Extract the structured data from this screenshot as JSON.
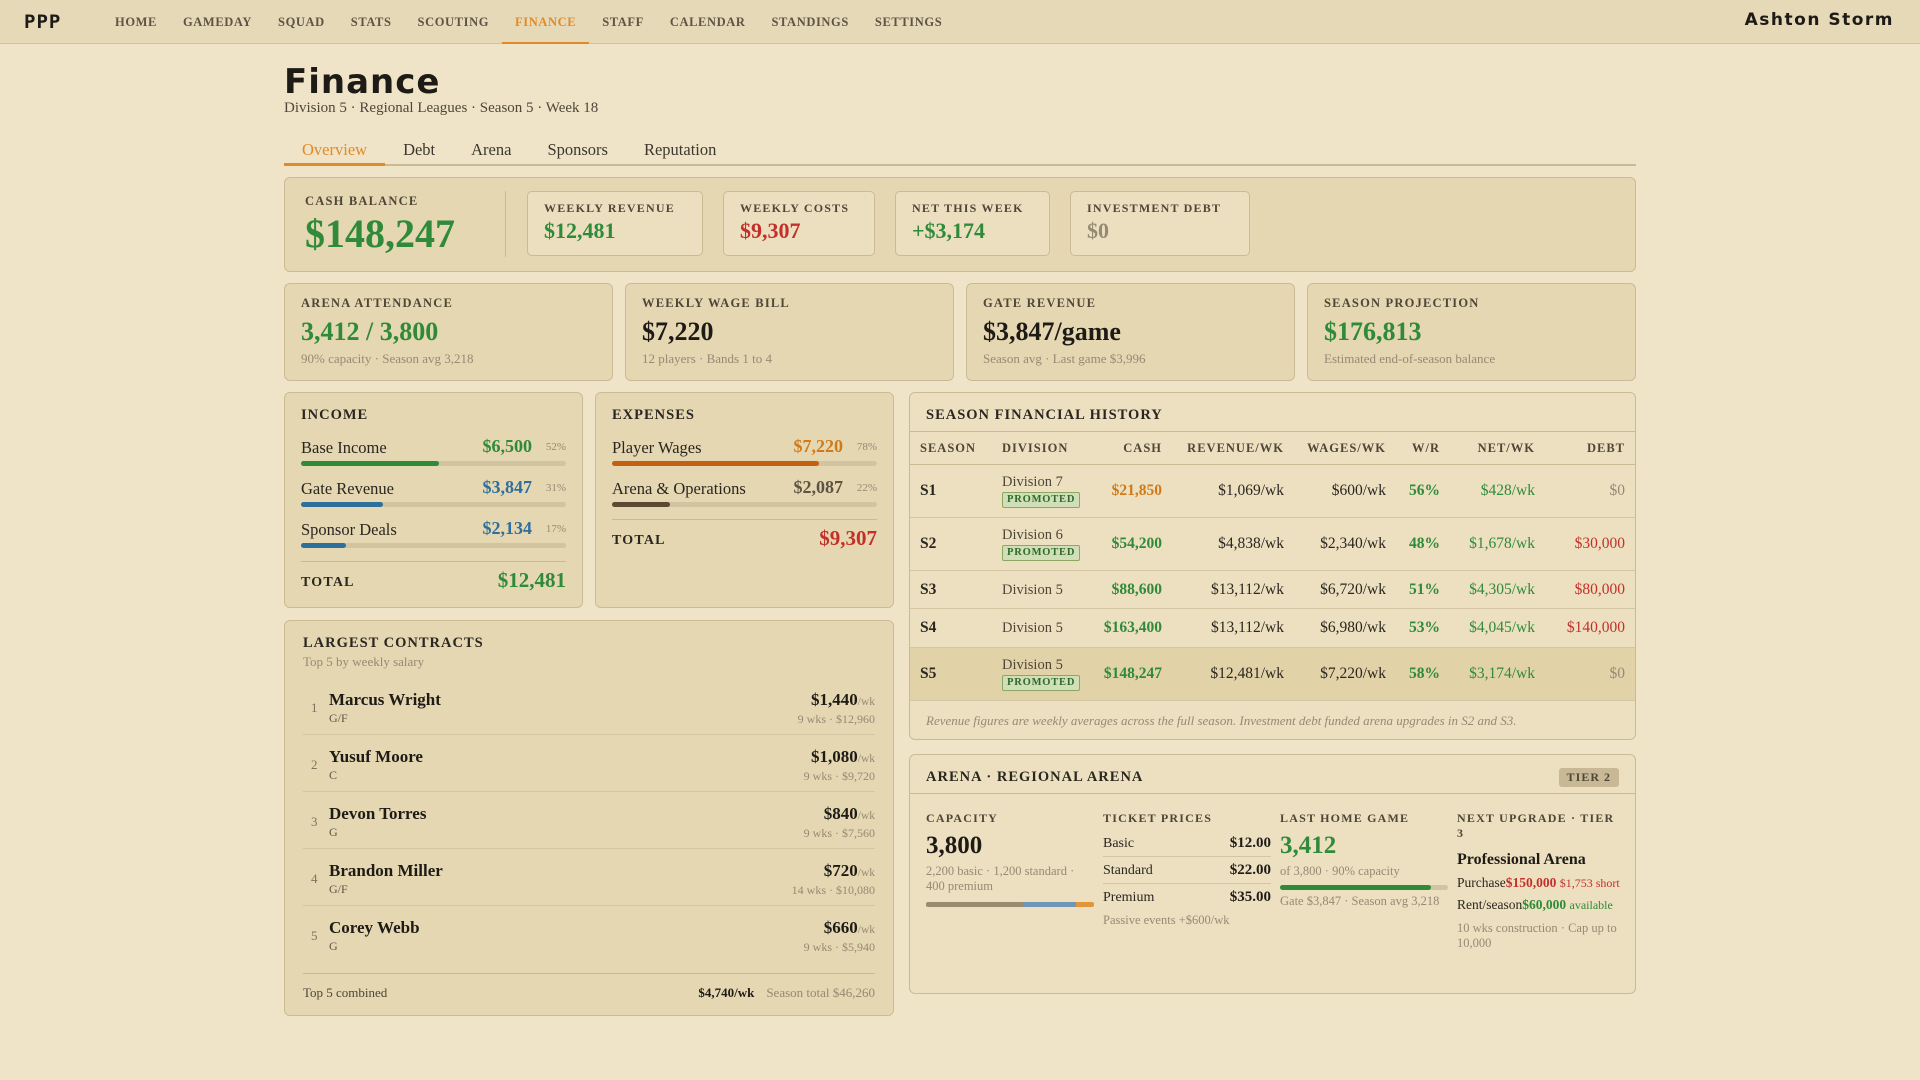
{
  "app": {
    "logo": "PPP",
    "user": "Ashton Storm"
  },
  "nav": [
    "HOME",
    "GAMEDAY",
    "SQUAD",
    "STATS",
    "SCOUTING",
    "FINANCE",
    "STAFF",
    "CALENDAR",
    "STANDINGS",
    "SETTINGS"
  ],
  "page": {
    "title": "Finance",
    "subtitle": "Division 5 · Regional Leagues · Season 5 · Week 18"
  },
  "tabs": [
    "Overview",
    "Debt",
    "Arena",
    "Sponsors",
    "Reputation"
  ],
  "hero": {
    "cash_label": "Cash Balance",
    "cash_value": "$148,247",
    "weekly_revenue_label": "Weekly Revenue",
    "weekly_revenue": "$12,481",
    "weekly_costs_label": "Weekly Costs",
    "weekly_costs": "$9,307",
    "net_label": "Net This Week",
    "net": "+$3,174",
    "debt_label": "Investment Debt",
    "debt": "$0"
  },
  "stats": [
    {
      "label": "Arena Attendance",
      "value": "3,412 / 3,800",
      "sub": "90% capacity · Season avg 3,218"
    },
    {
      "label": "Weekly Wage Bill",
      "value": "$7,220",
      "sub": "12 players · Bands 1 to 4"
    },
    {
      "label": "Gate Revenue",
      "value": "$3,847/game",
      "sub": "Season avg · Last game $3,996"
    },
    {
      "label": "Season Projection",
      "value": "$176,813",
      "sub": "Estimated end-of-season balance"
    }
  ],
  "income": {
    "title": "Income",
    "items": [
      {
        "name": "Base Income",
        "amount": "$6,500",
        "pct": "52%",
        "share": 0.52,
        "color": "#2f8a3a"
      },
      {
        "name": "Gate Revenue",
        "amount": "$3,847",
        "pct": "31%",
        "share": 0.31,
        "color": "#2e6f9c"
      },
      {
        "name": "Sponsor Deals",
        "amount": "$2,134",
        "pct": "17%",
        "share": 0.17,
        "color": "#2e6f9c"
      }
    ],
    "total_label": "Total",
    "total": "$12,481"
  },
  "expenses": {
    "title": "Expenses",
    "items": [
      {
        "name": "Player Wages",
        "amount": "$7,220",
        "pct": "78%",
        "share": 0.78,
        "color": "#c2610f"
      },
      {
        "name": "Arena & Operations",
        "amount": "$2,087",
        "pct": "22%",
        "share": 0.22,
        "color": "#5e4a32"
      }
    ],
    "total_label": "Total",
    "total": "$9,307"
  },
  "contracts": {
    "title": "Largest Contracts",
    "subtitle": "Top 5 by weekly salary",
    "rows": [
      {
        "rank": "1",
        "name": "Marcus Wright",
        "pos": "G/F",
        "salary": "$1,440",
        "unit": "/wk",
        "detail": "9 wks · $12,960"
      },
      {
        "rank": "2",
        "name": "Yusuf Moore",
        "pos": "C",
        "salary": "$1,080",
        "unit": "/wk",
        "detail": "9 wks · $9,720"
      },
      {
        "rank": "3",
        "name": "Devon Torres",
        "pos": "G",
        "salary": "$840",
        "unit": "/wk",
        "detail": "9 wks · $7,560"
      },
      {
        "rank": "4",
        "name": "Brandon Miller",
        "pos": "G/F",
        "salary": "$720",
        "unit": "/wk",
        "detail": "14 wks · $10,080"
      },
      {
        "rank": "5",
        "name": "Corey Webb",
        "pos": "G",
        "salary": "$660",
        "unit": "/wk",
        "detail": "9 wks · $5,940"
      }
    ],
    "footer_label": "Top 5 combined",
    "footer_weekly": "$4,740/wk",
    "footer_total": "Season total $46,260"
  },
  "history": {
    "title": "Season Financial History",
    "headers": [
      "Season",
      "Division",
      "Cash",
      "Revenue/wk",
      "Wages/wk",
      "W/R",
      "Net/wk",
      "Debt"
    ],
    "rows": [
      {
        "season": "S1",
        "division": "Division 7",
        "badge": "PROMOTED",
        "cash": "$21,850",
        "cash_color": "orange",
        "revenue": "$1,069/wk",
        "wages": "$600/wk",
        "wr": "56%",
        "net": "$428/wk",
        "debt": "$0",
        "debt_color": "gray"
      },
      {
        "season": "S2",
        "division": "Division 6",
        "badge": "PROMOTED",
        "cash": "$54,200",
        "cash_color": "green",
        "revenue": "$4,838/wk",
        "wages": "$2,340/wk",
        "wr": "48%",
        "net": "$1,678/wk",
        "debt": "$30,000",
        "debt_color": "red"
      },
      {
        "season": "S3",
        "division": "Division 5",
        "badge": "",
        "cash": "$88,600",
        "cash_color": "green",
        "revenue": "$13,112/wk",
        "wages": "$6,720/wk",
        "wr": "51%",
        "net": "$4,305/wk",
        "debt": "$80,000",
        "debt_color": "red"
      },
      {
        "season": "S4",
        "division": "Division 5",
        "badge": "",
        "cash": "$163,400",
        "cash_color": "green",
        "revenue": "$13,112/wk",
        "wages": "$6,980/wk",
        "wr": "53%",
        "net": "$4,045/wk",
        "debt": "$140,000",
        "debt_color": "red"
      },
      {
        "season": "S5",
        "division": "Division 5",
        "badge": "PROMOTED",
        "cash": "$148,247",
        "cash_color": "green",
        "revenue": "$12,481/wk",
        "wages": "$7,220/wk",
        "wr": "58%",
        "net": "$3,174/wk",
        "debt": "$0",
        "debt_color": "gray"
      }
    ],
    "note": "Revenue figures are weekly averages across the full season. Investment debt funded arena upgrades in S2 and S3."
  },
  "arena": {
    "title": "Arena · Regional Arena",
    "tier": "TIER 2",
    "capacity_label": "Capacity",
    "capacity": "3,800",
    "capacity_sub": "2,200 basic · 1,200 standard · 400 premium",
    "capacity_segments": [
      {
        "share": 0.579,
        "color": "#9a8c6e"
      },
      {
        "share": 0.316,
        "color": "#6f96b4"
      },
      {
        "share": 0.105,
        "color": "#e2963a"
      }
    ],
    "tickets_label": "Ticket Prices",
    "tickets": [
      {
        "name": "Basic",
        "price": "$12.00"
      },
      {
        "name": "Standard",
        "price": "$22.00"
      },
      {
        "name": "Premium",
        "price": "$35.00"
      }
    ],
    "passive": "Passive events +$600/wk",
    "last_label": "Last Home Game",
    "last_value": "3,412",
    "last_sub": "of 3,800 · 90% capacity",
    "last_fill": 0.9,
    "last_sub2": "Gate $3,847 · Season avg 3,218",
    "upgrade_label": "Next Upgrade · Tier 3",
    "upgrade_name": "Professional Arena",
    "purchase_label": "Purchase",
    "purchase_price": "$150,000",
    "purchase_short": "$1,753 short",
    "rent_label": "Rent/season",
    "rent_price": "$60,000",
    "rent_note": "available",
    "upgrade_note": "10 wks construction · Cap up to 10,000"
  }
}
